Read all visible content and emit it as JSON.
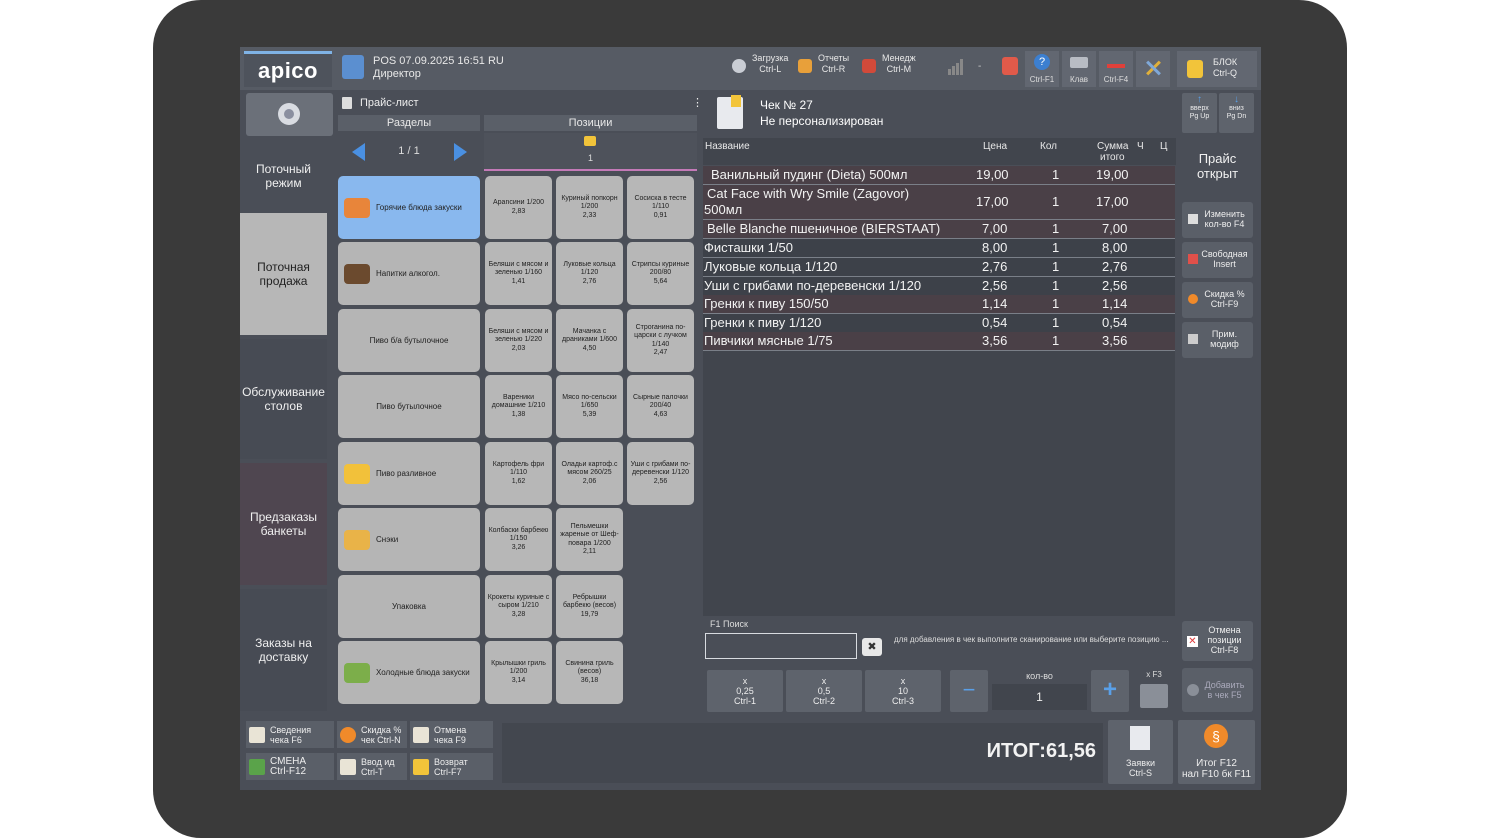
{
  "topbar": {
    "logo": "apico",
    "pos_line": "POS 07.09.2025 16:51  RU",
    "role": "Директор",
    "buttons": [
      {
        "label": "Загрузка",
        "key": "Ctrl-L"
      },
      {
        "label": "Отчеты",
        "key": "Ctrl-R"
      },
      {
        "label": "Менедж",
        "key": "Ctrl-M"
      }
    ],
    "dash": "-",
    "help_key": "Ctrl-F1",
    "kbd_label": "Клав",
    "f4_key": "Ctrl-F4",
    "lock_label": "БЛОК",
    "lock_key": "Ctrl-Q"
  },
  "leftnav": {
    "items": [
      {
        "label": "Поточный режим"
      },
      {
        "label": "Поточная продажа"
      },
      {
        "label": "Обслуживание столов"
      },
      {
        "label": "Предзаказы банкеты"
      },
      {
        "label": "Заказы на доставку"
      }
    ]
  },
  "pricelist": {
    "title": "Прайс-лист",
    "sections_label": "Разделы",
    "positions_label": "Позиции",
    "page": "1 / 1",
    "folder_count": "1",
    "categories": [
      {
        "label": "Горячие блюда закуски",
        "color": "#e8853a"
      },
      {
        "label": "Напитки  алкогол.",
        "color": "#6b4a2e"
      },
      {
        "label": "Пиво б/а бутылочное",
        "color": ""
      },
      {
        "label": "Пиво бутылочное",
        "color": ""
      },
      {
        "label": "Пиво разливное",
        "color": "#f2c13a"
      },
      {
        "label": "Снэки",
        "color": "#e9b348"
      },
      {
        "label": "Упаковка",
        "color": ""
      },
      {
        "label": "Холодные блюда закуски",
        "color": "#7cae4a"
      }
    ],
    "items": [
      [
        "Арancини 1/200",
        "2,83"
      ]
    ]
  },
  "items_grid": [
    {
      "name": "Арancини 1/200",
      "price": "2,83"
    },
    {
      "name": "Куриный попкорн 1/200",
      "price": "2,33"
    },
    {
      "name": "Сосиска в тесте 1/110",
      "price": "0,91"
    },
    {
      "name": "Беляши с мясом и зеленью 1/160",
      "price": "1,41"
    },
    {
      "name": "Луковые кольца 1/120",
      "price": "2,76"
    },
    {
      "name": "Стрипсы куриные 200/80",
      "price": "5,64"
    },
    {
      "name": "Беляши с мясом и зеленью 1/220",
      "price": "2,03"
    },
    {
      "name": "Мачанка с драниками 1/600",
      "price": "4,50"
    },
    {
      "name": "Строганина по-царски с лучком 1/140",
      "price": "2,47"
    },
    {
      "name": "Вареники домашние 1/210",
      "price": "1,38"
    },
    {
      "name": "Мясо по-сельски 1/650",
      "price": "5,39"
    },
    {
      "name": "Сырные палочки 200/40",
      "price": "4,63"
    },
    {
      "name": "Картофель фри 1/110",
      "price": "1,62"
    },
    {
      "name": "Оладьи картоф.с мясом 260/25",
      "price": "2,06"
    },
    {
      "name": "Уши с грибами по-деревенски 1/120",
      "price": "2,56"
    },
    {
      "name": "Колбаски барбекю 1/150",
      "price": "3,26"
    },
    {
      "name": "Пельмешки жареные от Шеф-повара 1/200",
      "price": "2,11"
    },
    {
      "name": "Крокеты куриные с сыром 1/210",
      "price": "3,28"
    },
    {
      "name": "Ребрышки барбекю (весов)",
      "price": "19,79"
    },
    {
      "name": "Крылышки гриль 1/200",
      "price": "3,14"
    },
    {
      "name": "Свинина гриль (весов)",
      "price": "36,18"
    }
  ],
  "receipt": {
    "title": "Чек № 27",
    "subtitle": "Не персонализирован",
    "up_label": "вверх",
    "up_key": "Pg Up",
    "down_label": "вниз",
    "down_key": "Pg Dn",
    "headers": {
      "name": "Название",
      "price": "Цена",
      "qty": "Кол",
      "sum1": "Сумма",
      "sum2": "итого",
      "ch": "Ч",
      "ts": "Ц"
    },
    "rows": [
      {
        "name": "Ванильный пудинг (Dieta) 500мл",
        "price": "19,00",
        "qty": "1",
        "sum": "19,00"
      },
      {
        "name": "Cat Face with Wry Smile  (Zagovor)",
        "name2": "500мл",
        "price": "17,00",
        "qty": "1",
        "sum": "17,00"
      },
      {
        "name": "Belle Blanche  пшеничное (BIERSTAAT)",
        "price": "7,00",
        "qty": "1",
        "sum": "7,00"
      },
      {
        "name": "Фисташки 1/50",
        "price": "8,00",
        "qty": "1",
        "sum": "8,00"
      },
      {
        "name": "Луковые кольца 1/120",
        "price": "2,76",
        "qty": "1",
        "sum": "2,76"
      },
      {
        "name": "Уши с грибами по-деревенски 1/120",
        "price": "2,56",
        "qty": "1",
        "sum": "2,56"
      },
      {
        "name": "Гренки к пиву 150/50",
        "price": "1,14",
        "qty": "1",
        "sum": "1,14"
      },
      {
        "name": "Гренки к пиву 1/120",
        "price": "0,54",
        "qty": "1",
        "sum": "0,54"
      },
      {
        "name": "Пивчики мясные 1/75",
        "price": "3,56",
        "qty": "1",
        "sum": "3,56"
      }
    ]
  },
  "sidepanel": {
    "status": "Прайс открыт",
    "buttons": [
      {
        "l1": "Изменить",
        "l2": "кол-во F4"
      },
      {
        "l1": "Свободная",
        "l2": "Insert"
      },
      {
        "l1": "Скидка %",
        "l2": "Ctrl-F9"
      },
      {
        "l1": "Прим.",
        "l2": "модиф"
      }
    ],
    "cancel": {
      "l1": "Отмена",
      "l2": "позиции",
      "l3": "Ctrl-F8"
    },
    "add": {
      "l1": "Добавить",
      "l2": "в чек F5"
    }
  },
  "search": {
    "label": "F1 Поиск",
    "value": "",
    "hint": "для добавления в чек выполните сканирование или выберите позицию ..."
  },
  "qty": {
    "m1": {
      "x": "x",
      "v": "0,25",
      "k": "Ctrl-1"
    },
    "m2": {
      "x": "x",
      "v": "0,5",
      "k": "Ctrl-2"
    },
    "m3": {
      "x": "x",
      "v": "10",
      "k": "Ctrl-3"
    },
    "minus": "−",
    "label": "кол-во",
    "value": "1",
    "plus": "+",
    "f3": "x F3"
  },
  "bottom": {
    "buttons": [
      {
        "l1": "Сведения",
        "l2": "чека F6",
        "color": "#e9e4d6"
      },
      {
        "l1": "Скидка %",
        "l2": "чек Ctrl-N",
        "color": "#f08a2a"
      },
      {
        "l1": "Отмена",
        "l2": "чека F9",
        "color": "#e9e4d6"
      },
      {
        "l1": "СМЕНА",
        "l2": "Ctrl-F12",
        "color": "#5aa34a"
      },
      {
        "l1": "Ввод ид",
        "l2": "Ctrl-T",
        "color": "#e9e4d6"
      },
      {
        "l1": "Возврат",
        "l2": "Ctrl-F7",
        "color": "#f2c43a"
      }
    ],
    "total": "ИТОГ:61,56",
    "orders": {
      "l1": "Заявки",
      "l2": "Ctrl-S"
    },
    "final": {
      "l1": "Итог F12",
      "l2": "нал F10 бк F11"
    }
  }
}
